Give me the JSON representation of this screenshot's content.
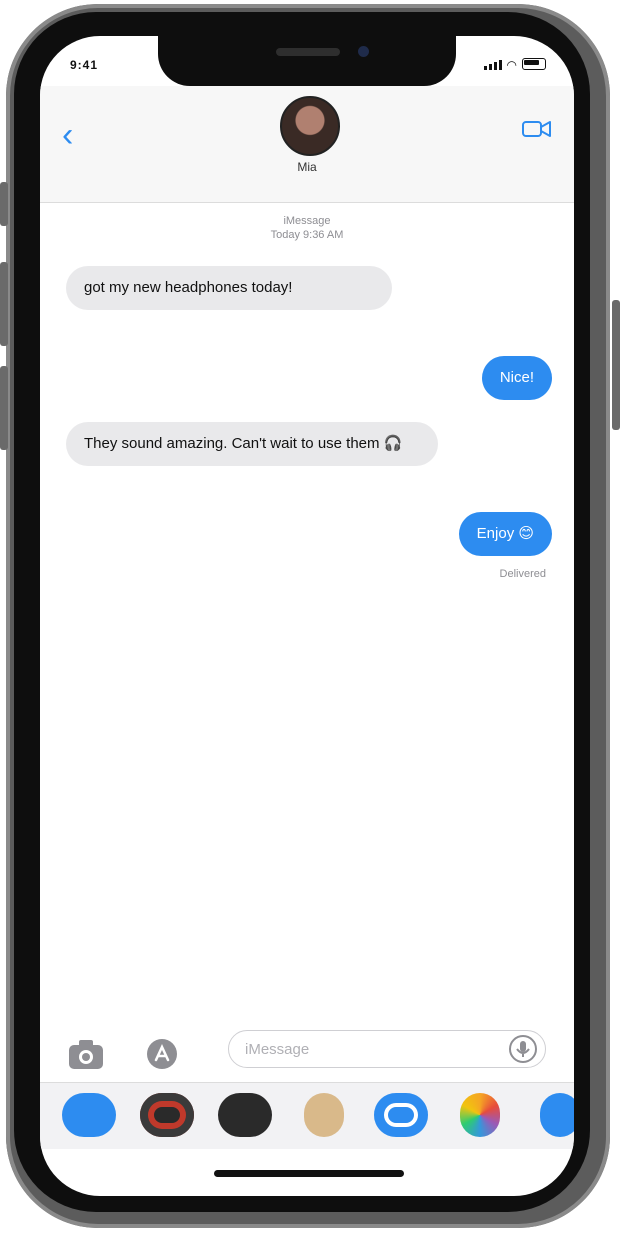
{
  "status_bar": {
    "time": "9:41"
  },
  "header": {
    "contact_name": "Mia"
  },
  "thread": {
    "timestamp_line1": "iMessage",
    "timestamp_line2": "Today 9:36 AM",
    "messages": [
      {
        "direction": "in",
        "text": "got my new headphones today!"
      },
      {
        "direction": "out",
        "text": "Nice!"
      },
      {
        "direction": "in",
        "text": "They sound amazing. Can't wait to use them 🎧"
      },
      {
        "direction": "out",
        "text": "Enjoy 😊"
      }
    ],
    "delivered_label": "Delivered"
  },
  "input_bar": {
    "placeholder": "iMessage"
  },
  "app_drawer": {
    "apps": [
      {
        "name": "app-store-icon",
        "color": "#2d8cf0"
      },
      {
        "name": "activity-icon",
        "color": "#2a2a2a"
      },
      {
        "name": "digital-touch-icon",
        "color": "#2a2a2a"
      },
      {
        "name": "memoji-icon",
        "color": "#d9b98a"
      },
      {
        "name": "apple-pay-icon",
        "color": "#2d8cf0"
      },
      {
        "name": "photos-icon",
        "color": "#f5a623"
      },
      {
        "name": "more-apps-icon",
        "color": "#2d8cf0"
      }
    ]
  },
  "colors": {
    "accent_blue": "#2d8cf0",
    "incoming_bubble": "#e9e9eb",
    "meta_gray": "#8e8e93"
  }
}
